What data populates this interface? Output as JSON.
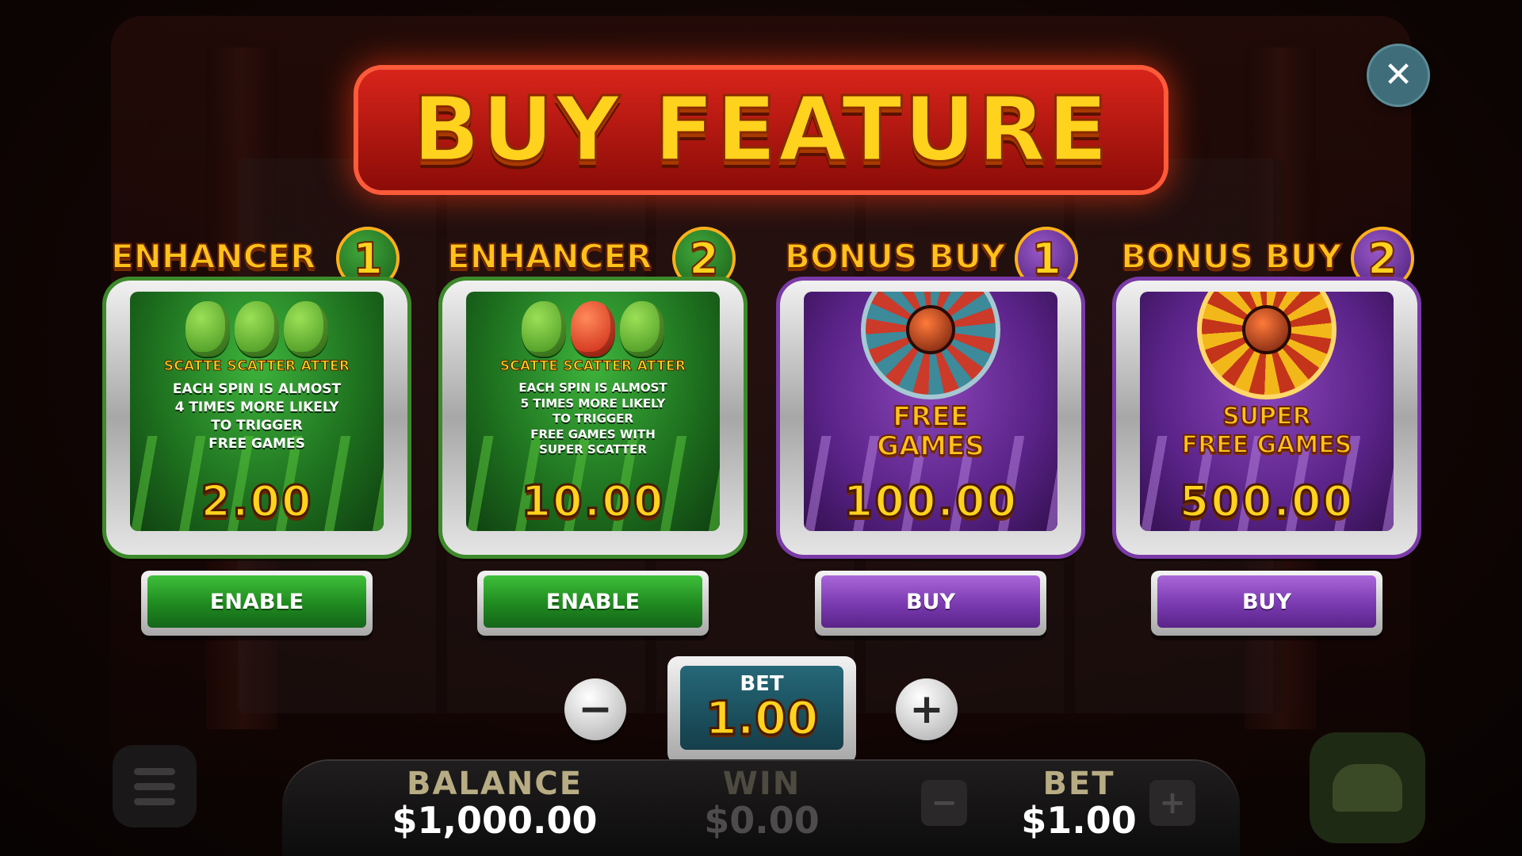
{
  "title": "BUY FEATURE",
  "close": {
    "icon": "close-icon"
  },
  "cards": [
    {
      "head": "ENHANCER",
      "num": "1",
      "theme": "green",
      "scatter_text": "SCATTE SCATTER ATTER",
      "description": "EACH SPIN IS ALMOST\n4 TIMES MORE LIKELY\nTO TRIGGER\nFREE GAMES",
      "price": "2.00",
      "button": "ENABLE"
    },
    {
      "head": "ENHANCER",
      "num": "2",
      "theme": "green",
      "scatter_text": "SCATTE SCATTER ATTER",
      "description": "EACH SPIN IS ALMOST\n5 TIMES MORE LIKELY\nTO TRIGGER\nFREE GAMES WITH\nSUPER SCATTER",
      "price": "10.00",
      "button": "ENABLE"
    },
    {
      "head": "BONUS BUY",
      "num": "1",
      "theme": "purple",
      "feature": "FREE\nGAMES",
      "price": "100.00",
      "button": "BUY"
    },
    {
      "head": "BONUS BUY",
      "num": "2",
      "theme": "purple",
      "feature": "SUPER\nFREE GAMES",
      "price": "500.00",
      "button": "BUY"
    }
  ],
  "bet_selector": {
    "label": "BET",
    "value": "1.00",
    "minus": "−",
    "plus": "+"
  },
  "hud": {
    "balance_label": "BALANCE",
    "balance_value": "$1,000.00",
    "win_label": "WIN",
    "win_value": "$0.00",
    "bet_label": "BET",
    "bet_value": "$1.00",
    "minus": "−",
    "plus": "+"
  },
  "colors": {
    "accent_gold": "#ffd21e",
    "green": "#1f8a1f",
    "purple": "#7a3ab0",
    "close": "#3f6e7a"
  }
}
